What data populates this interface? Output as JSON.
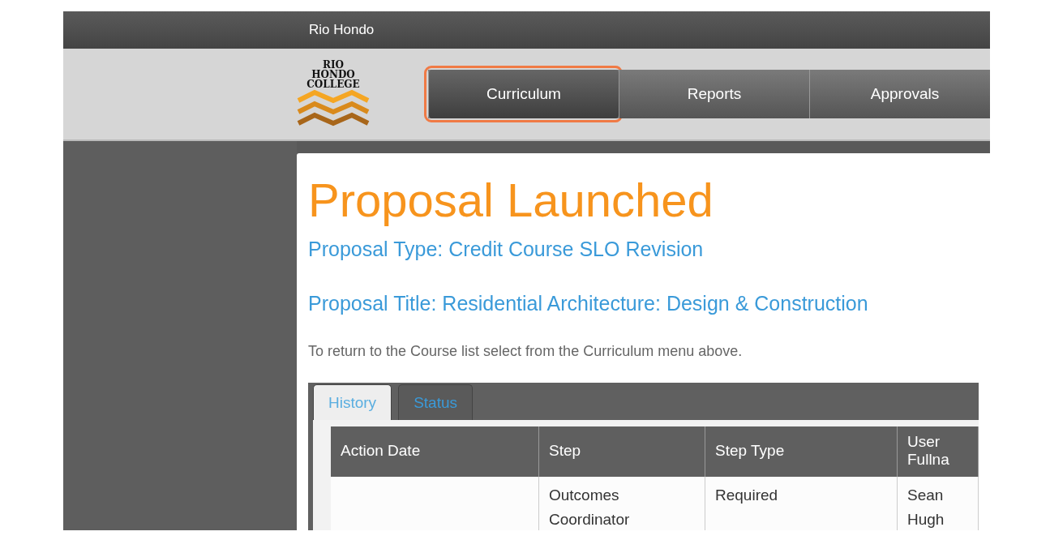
{
  "top_bar": {
    "title": "Rio Hondo"
  },
  "logo": {
    "lines": [
      "RIO",
      "HONDO",
      "COLLEGE"
    ]
  },
  "nav": [
    {
      "label": "Curriculum",
      "selected": true,
      "highlighted": true
    },
    {
      "label": "Reports",
      "selected": false,
      "highlighted": false
    },
    {
      "label": "Approvals",
      "selected": false,
      "highlighted": false
    }
  ],
  "heading": "Proposal Launched",
  "proposal_type": "Proposal Type: Credit Course SLO Revision",
  "proposal_title": "Proposal Title: Residential Architecture: Design & Construction",
  "instruction": "To return to the Course list select from the Curriculum menu above.",
  "tabs": [
    {
      "label": "History",
      "selected": true
    },
    {
      "label": "Status",
      "selected": false
    }
  ],
  "table": {
    "columns": [
      "Action Date",
      "Step",
      "Step Type",
      "User Fullna"
    ],
    "rows": [
      [
        "",
        "Outcomes Coordinator",
        "Required",
        "Sean Hugh"
      ]
    ]
  }
}
